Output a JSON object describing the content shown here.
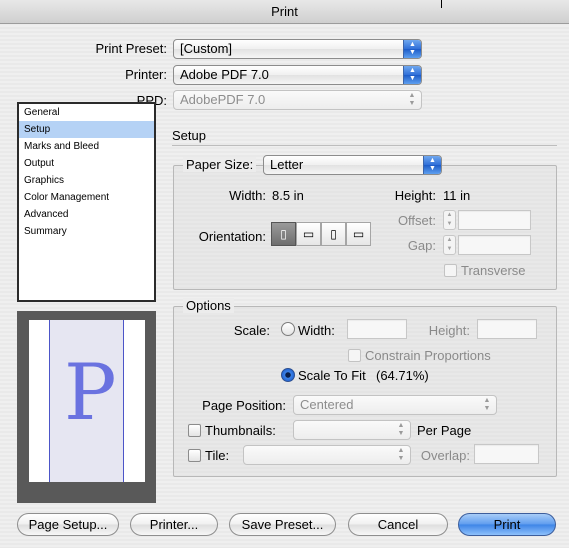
{
  "window": {
    "title": "Print"
  },
  "presets": {
    "print_preset_label": "Print Preset:",
    "print_preset_value": "[Custom]",
    "printer_label": "Printer:",
    "printer_value": "Adobe PDF 7.0",
    "ppd_label": "PPD:",
    "ppd_value": "AdobePDF 7.0"
  },
  "sidebar": {
    "items": [
      {
        "label": "General"
      },
      {
        "label": "Setup"
      },
      {
        "label": "Marks and Bleed"
      },
      {
        "label": "Output"
      },
      {
        "label": "Graphics"
      },
      {
        "label": "Color Management"
      },
      {
        "label": "Advanced"
      },
      {
        "label": "Summary"
      }
    ],
    "selected_index": 1
  },
  "preview": {
    "letter": "P"
  },
  "setup": {
    "section_title": "Setup",
    "paper_size_label": "Paper Size:",
    "paper_size_value": "Letter",
    "width_label": "Width:",
    "width_value": "8.5 in",
    "height_label": "Height:",
    "height_value": "11 in",
    "offset_label": "Offset:",
    "gap_label": "Gap:",
    "orientation_label": "Orientation:",
    "transverse_label": "Transverse"
  },
  "options": {
    "title": "Options",
    "scale_label": "Scale:",
    "width_label": "Width:",
    "height_label": "Height:",
    "constrain_label": "Constrain Proportions",
    "scale_to_fit_label": "Scale To Fit",
    "scale_to_fit_value": "(64.71%)",
    "page_position_label": "Page Position:",
    "page_position_value": "Centered",
    "thumbnails_label": "Thumbnails:",
    "per_page_label": "Per Page",
    "tile_label": "Tile:",
    "overlap_label": "Overlap:"
  },
  "buttons": {
    "page_setup": "Page Setup...",
    "printer": "Printer...",
    "save_preset": "Save Preset...",
    "cancel": "Cancel",
    "print": "Print"
  }
}
